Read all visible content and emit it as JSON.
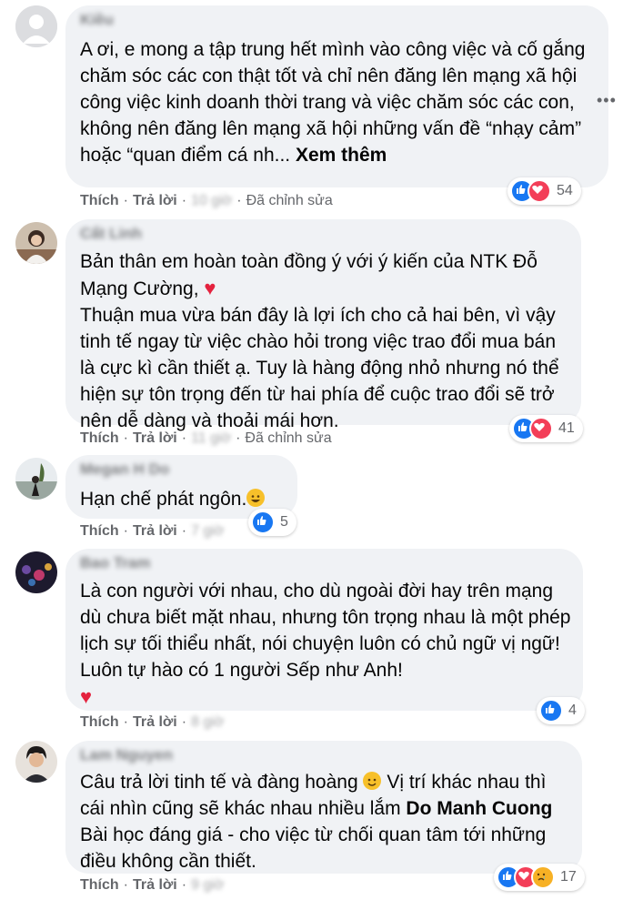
{
  "more_menu": "•••",
  "actions": {
    "like": "Thích",
    "reply": "Trả lời",
    "edited": "Đã chỉnh sửa",
    "sep": "·"
  },
  "comments": [
    {
      "author": "Kiều",
      "text": "A ơi, e mong a tập trung hết mình vào công việc và cố gắng chăm sóc các con thật tốt và chỉ nên đăng lên mạng xã hội công việc kinh doanh thời trang và việc chăm sóc các con, không nên đăng lên mạng xã hội những vấn đề “nhạy cảm” hoặc “quan điểm cá nh... ",
      "see_more": "Xem thêm",
      "time": "10 giờ",
      "reaction_count": "54"
    },
    {
      "author": "Cẩt Linh",
      "text": "Bản thân em hoàn toàn đồng ý với ý kiến của NTK Đỗ Mạng Cường, ",
      "heart": "♥",
      "text2": "\nThuận mua vừa bán đây là lợi ích cho cả hai bên, vì vậy tinh tế ngay từ việc chào hỏi trong việc trao đổi mua bán là cực kì cần thiết ạ. Tuy là hàng động nhỏ nhưng nó thể hiện sự tôn trọng đến từ hai phía để cuộc trao đổi sẽ trở nên dễ dàng và thoải mái hơn.",
      "time": "11 giờ",
      "reaction_count": "41"
    },
    {
      "author": "Megan H Do",
      "text": "Hạn chế phát ngôn.",
      "time": "7 giờ",
      "reaction_count": "5"
    },
    {
      "author": "Bao Tram",
      "text": "Là con người với nhau, cho dù ngoài đời hay trên mạng dù chưa biết mặt nhau, nhưng tôn trọng nhau là một phép lịch sự tối thiểu nhất, nói chuyện luôn có chủ ngữ vị ngữ! Luôn tự hào có 1 người Sếp như Anh!",
      "heart": "♥",
      "time": "8 giờ",
      "reaction_count": "4"
    },
    {
      "author": "Lam Nguyen",
      "text": "Câu trả lời tinh tế và đàng hoàng ",
      "text2": " Vị trí khác nhau thì cái nhìn cũng sẽ khác nhau nhiều lắm ",
      "mention": "Do Manh Cuong",
      "text3": " Bài học đáng giá - cho việc từ chối quan tâm tới những điều không cần thiết.",
      "time": "9 giờ",
      "reaction_count": "17"
    }
  ]
}
